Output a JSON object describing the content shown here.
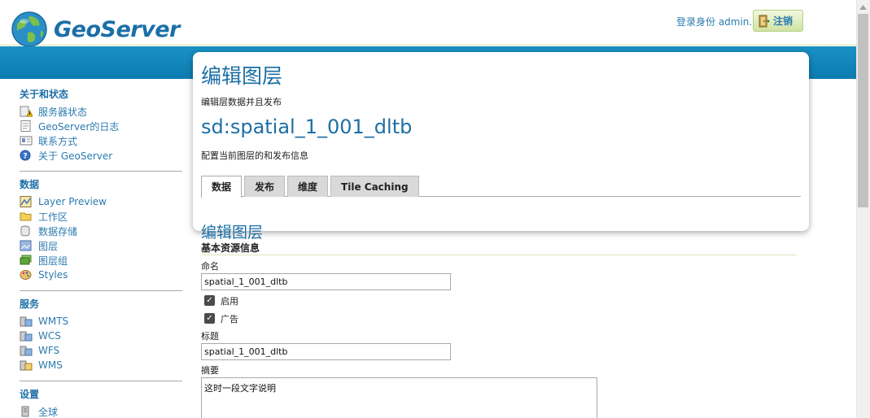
{
  "header": {
    "logo_text": "GeoServer",
    "login_text": "登录身份 admin.",
    "logout_label": "注销"
  },
  "sidebar": {
    "sections": [
      {
        "title": "关于和状态",
        "items": [
          {
            "label": "服务器状态",
            "icon": "warning-icon"
          },
          {
            "label": "GeoServer的日志",
            "icon": "document-icon"
          },
          {
            "label": "联系方式",
            "icon": "contact-card-icon"
          },
          {
            "label": "关于 GeoServer",
            "icon": "help-icon"
          }
        ]
      },
      {
        "title": "数据",
        "items": [
          {
            "label": "Layer Preview",
            "icon": "map-preview-icon"
          },
          {
            "label": "工作区",
            "icon": "folder-icon"
          },
          {
            "label": "数据存储",
            "icon": "database-icon"
          },
          {
            "label": "图层",
            "icon": "picture-icon"
          },
          {
            "label": "图层组",
            "icon": "layers-icon"
          },
          {
            "label": "Styles",
            "icon": "palette-icon"
          }
        ]
      },
      {
        "title": "服务",
        "items": [
          {
            "label": "WMTS",
            "icon": "server-icon"
          },
          {
            "label": "WCS",
            "icon": "server-icon"
          },
          {
            "label": "WFS",
            "icon": "server-icon"
          },
          {
            "label": "WMS",
            "icon": "server-icon"
          }
        ]
      },
      {
        "title": "设置",
        "items": [
          {
            "label": "全球",
            "icon": "server-settings-icon"
          }
        ]
      }
    ]
  },
  "panel": {
    "title": "编辑图层",
    "description": "编辑层数据并且发布",
    "layer_name": "sd:spatial_1_001_dltb",
    "layer_description": "配置当前图层的和发布信息",
    "tabs": [
      "数据",
      "发布",
      "维度",
      "Tile Caching"
    ],
    "active_tab": "数据"
  },
  "form": {
    "title": "编辑图层",
    "subtitle": "基本资源信息",
    "name_label": "命名",
    "name_value": "spatial_1_001_dltb",
    "enabled_label": "启用",
    "enabled": true,
    "advertised_label": "广告",
    "advertised": true,
    "title_label": "标题",
    "title_value": "spatial_1_001_dltb",
    "abstract_label": "摘要",
    "abstract_value": "这时一段文字说明"
  },
  "colors": {
    "brand_blue": "#1d6fa5",
    "band_blue": "#1a91c4",
    "link_blue": "#2b7bb0"
  }
}
